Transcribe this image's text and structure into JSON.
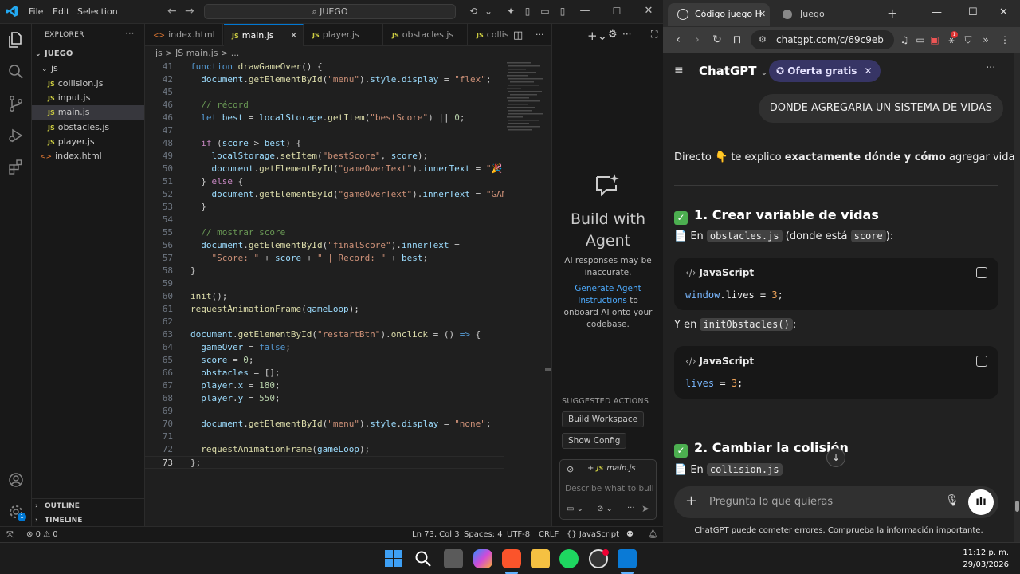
{
  "vscode": {
    "menu": [
      "File",
      "Edit",
      "Selection"
    ],
    "command_center": "JUEGO",
    "explorer_title": "EXPLORER",
    "project": "JUEGO",
    "folder": "js",
    "files": [
      {
        "name": "collision.js",
        "type": "js"
      },
      {
        "name": "input.js",
        "type": "js"
      },
      {
        "name": "main.js",
        "type": "js",
        "selected": true
      },
      {
        "name": "obstacles.js",
        "type": "js"
      },
      {
        "name": "player.js",
        "type": "js"
      },
      {
        "name": "index.html",
        "type": "html"
      }
    ],
    "outline_label": "OUTLINE",
    "timeline_label": "TIMELINE",
    "tabs": [
      {
        "label": "index.html",
        "type": "html"
      },
      {
        "label": "main.js",
        "type": "js",
        "active": true
      },
      {
        "label": "player.js",
        "type": "js"
      },
      {
        "label": "obstacles.js",
        "type": "js"
      },
      {
        "label": "collis",
        "type": "js"
      }
    ],
    "breadcrumb": "js  >  JS main.js  >  ...",
    "chat": {
      "title": "Build with Agent",
      "warning": "AI responses may be inaccurate.",
      "link": "Generate Agent Instructions",
      "link_suffix": "to onboard AI onto your codebase.",
      "suggested": "SUGGESTED ACTIONS",
      "actions": [
        "Build Workspace",
        "Show Config"
      ],
      "context_file": "main.js",
      "input_placeholder": "Describe what to buil"
    },
    "status": {
      "errors": "0",
      "warnings": "0",
      "position": "Ln 73, Col 3",
      "spaces": "Spaces: 4",
      "encoding": "UTF-8",
      "eol": "CRLF",
      "language": "JavaScript",
      "accounts_badge": "1"
    }
  },
  "browser": {
    "tabs": [
      "Código juego H",
      "Juego"
    ],
    "url": "chatgpt.com/c/69c9eb",
    "app_name": "ChatGPT",
    "offer": "Oferta gratis",
    "user_message": "DONDE AGREGARIA UN SISTEMA DE VIDAS",
    "intro_a": "Directo 👇 te explico ",
    "intro_b": "exactamente dónde y cómo",
    "intro_c": " agregar vidas 💗",
    "h1": "1. Crear variable de vidas",
    "p1_a": "📄 En ",
    "p1_code": "obstacles.js",
    "p1_b": " (donde está ",
    "p1_code2": "score",
    "p1_c": "):",
    "code1_lang": "JavaScript",
    "code1_a": "window",
    "code1_b": ".lives = ",
    "code1_n": "3",
    "code1_c": ";",
    "p2_a": "Y en ",
    "p2_code": "initObstacles()",
    "p2_b": ":",
    "code2_lang": "JavaScript",
    "code2_a": "lives",
    "code2_b": " = ",
    "code2_n": "3",
    "code2_c": ";",
    "h2": "2. Cambiar la colisión",
    "p3_a": "📄 En ",
    "p3_code": "collision.js",
    "composer_placeholder": "Pregunta lo que quieras",
    "disclaimer": "ChatGPT puede cometer errores. Comprueba la información importante.",
    "badge_count": "1"
  },
  "taskbar": {
    "time": "11:12 p. m.",
    "date": "29/03/2026"
  }
}
